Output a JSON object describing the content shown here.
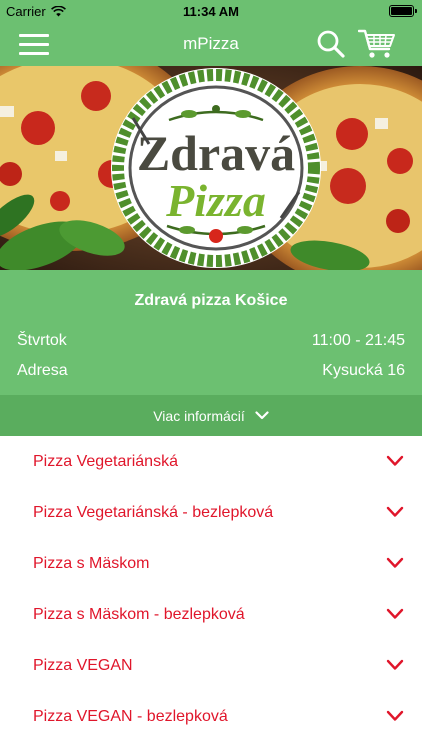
{
  "status_bar": {
    "carrier": "Carrier",
    "time": "11:34 AM"
  },
  "nav": {
    "title": "mPizza",
    "icons": [
      "menu-icon",
      "search-icon",
      "cart-icon"
    ]
  },
  "logo": {
    "line1": "Zdravá",
    "line2": "Pizza"
  },
  "info": {
    "shop_name": "Zdravá pizza Košice",
    "day_label": "Štvrtok",
    "hours": "11:00 - 21:45",
    "address_label": "Adresa",
    "address": "Kysucká 16",
    "more_label": "Viac informácií"
  },
  "categories": [
    {
      "label": "Pizza Vegetariánská"
    },
    {
      "label": "Pizza Vegetariánská - bezlepková"
    },
    {
      "label": "Pizza s Mäskom"
    },
    {
      "label": "Pizza s Mäskom - bezlepková"
    },
    {
      "label": "Pizza VEGAN"
    },
    {
      "label": "Pizza VEGAN - bezlepková"
    }
  ],
  "colors": {
    "green": "#6cc071",
    "green_dark": "#5aad5e",
    "accent_red": "#e0162b"
  }
}
